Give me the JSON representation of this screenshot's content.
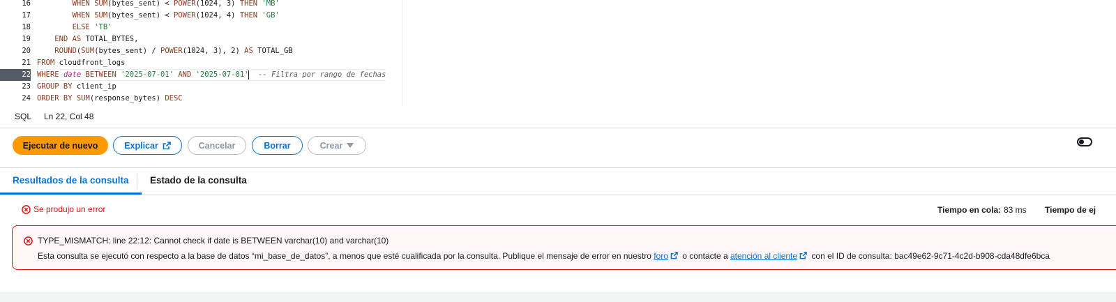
{
  "editor": {
    "lines": [
      {
        "num": "16",
        "indent": "        ",
        "tokens": [
          [
            "kw",
            "WHEN "
          ],
          [
            "fn",
            "SUM"
          ],
          [
            "ident",
            "(bytes_sent) < "
          ],
          [
            "fn",
            "POWER"
          ],
          [
            "ident",
            "(1024, 3) "
          ],
          [
            "kw",
            "THEN "
          ],
          [
            "str",
            "'MB'"
          ]
        ]
      },
      {
        "num": "17",
        "indent": "        ",
        "tokens": [
          [
            "kw",
            "WHEN "
          ],
          [
            "fn",
            "SUM"
          ],
          [
            "ident",
            "(bytes_sent) < "
          ],
          [
            "fn",
            "POWER"
          ],
          [
            "ident",
            "(1024, 4) "
          ],
          [
            "kw",
            "THEN "
          ],
          [
            "str",
            "'GB'"
          ]
        ]
      },
      {
        "num": "18",
        "indent": "        ",
        "tokens": [
          [
            "kw",
            "ELSE "
          ],
          [
            "str",
            "'TB'"
          ]
        ]
      },
      {
        "num": "19",
        "indent": "    ",
        "tokens": [
          [
            "kw",
            "END AS "
          ],
          [
            "ident",
            "TOTAL_BYTES,"
          ]
        ]
      },
      {
        "num": "20",
        "indent": "    ",
        "tokens": [
          [
            "fn",
            "ROUND"
          ],
          [
            "ident",
            "("
          ],
          [
            "fn",
            "SUM"
          ],
          [
            "ident",
            "(bytes_sent) / "
          ],
          [
            "fn",
            "POWER"
          ],
          [
            "ident",
            "(1024, 3), 2) "
          ],
          [
            "kw",
            "AS "
          ],
          [
            "ident",
            "TOTAL_GB"
          ]
        ]
      },
      {
        "num": "21",
        "indent": "",
        "tokens": [
          [
            "kw",
            "FROM "
          ],
          [
            "ident",
            "cloudfront_logs"
          ]
        ]
      },
      {
        "num": "22",
        "indent": "",
        "active": true,
        "tokens": [
          [
            "kw",
            "WHERE "
          ],
          [
            "var",
            "date"
          ],
          [
            "kw",
            " BETWEEN "
          ],
          [
            "str",
            "'2025-07-01'"
          ],
          [
            "kw",
            " AND "
          ],
          [
            "str",
            "'2025-07-01'"
          ],
          [
            "caret",
            ""
          ],
          [
            "cmt",
            "  -- Filtra por rango de fechas"
          ]
        ]
      },
      {
        "num": "23",
        "indent": "",
        "tokens": [
          [
            "kw",
            "GROUP BY "
          ],
          [
            "ident",
            "client_ip"
          ]
        ]
      },
      {
        "num": "24",
        "indent": "",
        "tokens": [
          [
            "kw",
            "ORDER BY "
          ],
          [
            "fn",
            "SUM"
          ],
          [
            "ident",
            "(response_bytes) "
          ],
          [
            "kw",
            "DESC"
          ]
        ]
      }
    ]
  },
  "status": {
    "language": "SQL",
    "cursor": "Ln 22, Col 48"
  },
  "toolbar": {
    "run_again": "Ejecutar de nuevo",
    "explain": "Explicar",
    "cancel": "Cancelar",
    "clear": "Borrar",
    "create": "Crear"
  },
  "tabs": {
    "results": "Resultados de la consulta",
    "status": "Estado de la consulta"
  },
  "results": {
    "error_summary": "Se produjo un error",
    "queue_label": "Tiempo en cola:",
    "queue_value": "83 ms",
    "exec_label": "Tiempo de ej",
    "error_title": "TYPE_MISMATCH: line 22:12: Cannot check if date is BETWEEN varchar(10) and varchar(10)",
    "detail_part1": "Esta consulta se ejecutó con respecto a la base de datos “mi_base_de_datos”, a menos que esté cualificada por la consulta. Publique el mensaje de error en nuestro",
    "forum_link": "foro",
    "detail_part2": "o contacte a",
    "support_link": "atención al cliente",
    "detail_part3": "con el ID de consulta: bac49e62-9c71-4c2d-b908-cda48dfe6bca"
  },
  "colors": {
    "primary": "#ff9900",
    "link": "#0972d3",
    "error": "#d91515"
  }
}
